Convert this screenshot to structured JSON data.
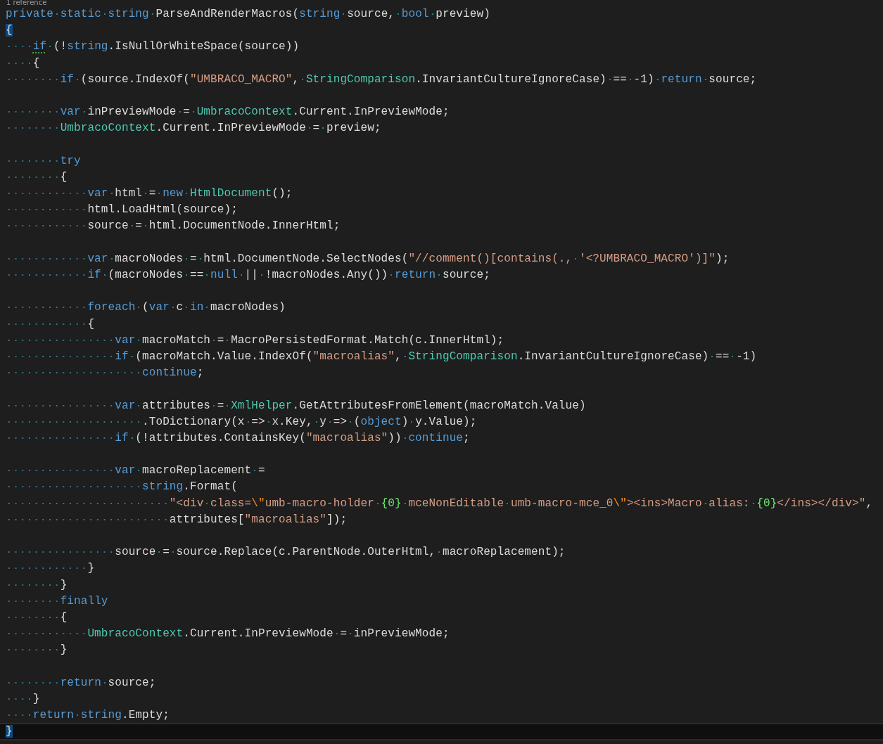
{
  "code_lens": "1 reference",
  "lines": [
    {
      "kind": "code",
      "current": false,
      "tokens": [
        {
          "kind": "kw",
          "text": "private static string "
        },
        {
          "kind": "txt",
          "text": "ParseAndRenderMacros("
        },
        {
          "kind": "kw",
          "text": "string"
        },
        {
          "kind": "txt",
          "text": " source, "
        },
        {
          "kind": "kw",
          "text": "bool"
        },
        {
          "kind": "txt",
          "text": " preview)"
        }
      ]
    },
    {
      "kind": "code",
      "current": false,
      "tokens": [
        {
          "kind": "match",
          "text": "{"
        }
      ]
    },
    {
      "kind": "code",
      "current": false,
      "tokens": [
        {
          "kind": "kwwarn",
          "text": "    if"
        },
        {
          "kind": "txt",
          "text": " (!"
        },
        {
          "kind": "kw",
          "text": "string"
        },
        {
          "kind": "txt",
          "text": ".IsNullOrWhiteSpace(source))"
        }
      ]
    },
    {
      "kind": "code",
      "current": false,
      "tokens": [
        {
          "kind": "txt",
          "text": "    {"
        }
      ]
    },
    {
      "kind": "code",
      "current": false,
      "tokens": [
        {
          "kind": "kw",
          "text": "        if"
        },
        {
          "kind": "txt",
          "text": " (source.IndexOf("
        },
        {
          "kind": "str",
          "text": "\"UMBRACO_MACRO\""
        },
        {
          "kind": "txt",
          "text": ", "
        },
        {
          "kind": "type",
          "text": "StringComparison"
        },
        {
          "kind": "txt",
          "text": ".InvariantCultureIgnoreCase) == -1) "
        },
        {
          "kind": "kw",
          "text": "return"
        },
        {
          "kind": "txt",
          "text": " source;"
        }
      ]
    },
    {
      "kind": "blank",
      "current": false
    },
    {
      "kind": "code",
      "current": false,
      "tokens": [
        {
          "kind": "kw",
          "text": "        var"
        },
        {
          "kind": "txt",
          "text": " inPreviewMode = "
        },
        {
          "kind": "type",
          "text": "UmbracoContext"
        },
        {
          "kind": "txt",
          "text": ".Current.InPreviewMode;"
        }
      ]
    },
    {
      "kind": "code",
      "current": false,
      "tokens": [
        {
          "kind": "type",
          "text": "        UmbracoContext"
        },
        {
          "kind": "txt",
          "text": ".Current.InPreviewMode = preview;"
        }
      ]
    },
    {
      "kind": "blank",
      "current": false
    },
    {
      "kind": "code",
      "current": false,
      "tokens": [
        {
          "kind": "kw",
          "text": "        try"
        }
      ]
    },
    {
      "kind": "code",
      "current": false,
      "tokens": [
        {
          "kind": "txt",
          "text": "        {"
        }
      ]
    },
    {
      "kind": "code",
      "current": false,
      "tokens": [
        {
          "kind": "kw",
          "text": "            var"
        },
        {
          "kind": "txt",
          "text": " html = "
        },
        {
          "kind": "kw",
          "text": "new "
        },
        {
          "kind": "type",
          "text": "HtmlDocument"
        },
        {
          "kind": "txt",
          "text": "();"
        }
      ]
    },
    {
      "kind": "code",
      "current": false,
      "tokens": [
        {
          "kind": "txt",
          "text": "            html.LoadHtml(source);"
        }
      ]
    },
    {
      "kind": "code",
      "current": false,
      "tokens": [
        {
          "kind": "txt",
          "text": "            source = html.DocumentNode.InnerHtml;"
        }
      ]
    },
    {
      "kind": "blank",
      "current": false
    },
    {
      "kind": "code",
      "current": false,
      "tokens": [
        {
          "kind": "kw",
          "text": "            var"
        },
        {
          "kind": "txt",
          "text": " macroNodes = html.DocumentNode.SelectNodes("
        },
        {
          "kind": "str",
          "text": "\"//comment()[contains(., '<?UMBRACO_MACRO')]\""
        },
        {
          "kind": "txt",
          "text": ");"
        }
      ]
    },
    {
      "kind": "code",
      "current": false,
      "tokens": [
        {
          "kind": "kw",
          "text": "            if"
        },
        {
          "kind": "txt",
          "text": " (macroNodes == "
        },
        {
          "kind": "kw",
          "text": "null"
        },
        {
          "kind": "txt",
          "text": " || !macroNodes.Any()) "
        },
        {
          "kind": "kw",
          "text": "return"
        },
        {
          "kind": "txt",
          "text": " source;"
        }
      ]
    },
    {
      "kind": "blank",
      "current": false
    },
    {
      "kind": "code",
      "current": false,
      "tokens": [
        {
          "kind": "kw",
          "text": "            foreach"
        },
        {
          "kind": "txt",
          "text": " ("
        },
        {
          "kind": "kw",
          "text": "var"
        },
        {
          "kind": "txt",
          "text": " c "
        },
        {
          "kind": "kw",
          "text": "in"
        },
        {
          "kind": "txt",
          "text": " macroNodes)"
        }
      ]
    },
    {
      "kind": "code",
      "current": false,
      "tokens": [
        {
          "kind": "txt",
          "text": "            {"
        }
      ]
    },
    {
      "kind": "code",
      "current": false,
      "tokens": [
        {
          "kind": "kw",
          "text": "                var"
        },
        {
          "kind": "txt",
          "text": " macroMatch = MacroPersistedFormat.Match(c.InnerHtml);"
        }
      ]
    },
    {
      "kind": "code",
      "current": false,
      "tokens": [
        {
          "kind": "kw",
          "text": "                if"
        },
        {
          "kind": "txt",
          "text": " (macroMatch.Value.IndexOf("
        },
        {
          "kind": "str",
          "text": "\"macroalias\""
        },
        {
          "kind": "txt",
          "text": ", "
        },
        {
          "kind": "type",
          "text": "StringComparison"
        },
        {
          "kind": "txt",
          "text": ".InvariantCultureIgnoreCase) == -1)"
        }
      ]
    },
    {
      "kind": "code",
      "current": false,
      "tokens": [
        {
          "kind": "kw",
          "text": "                    continue"
        },
        {
          "kind": "txt",
          "text": ";"
        }
      ]
    },
    {
      "kind": "blank",
      "current": false
    },
    {
      "kind": "code",
      "current": false,
      "tokens": [
        {
          "kind": "kw",
          "text": "                var"
        },
        {
          "kind": "txt",
          "text": " attributes = "
        },
        {
          "kind": "type",
          "text": "XmlHelper"
        },
        {
          "kind": "txt",
          "text": ".GetAttributesFromElement(macroMatch.Value)"
        }
      ]
    },
    {
      "kind": "code",
      "current": false,
      "tokens": [
        {
          "kind": "txt",
          "text": "                    .ToDictionary(x => x.Key, y => ("
        },
        {
          "kind": "kw",
          "text": "object"
        },
        {
          "kind": "txt",
          "text": ") y.Value);"
        }
      ]
    },
    {
      "kind": "code",
      "current": false,
      "tokens": [
        {
          "kind": "kw",
          "text": "                if"
        },
        {
          "kind": "txt",
          "text": " (!attributes.ContainsKey("
        },
        {
          "kind": "str",
          "text": "\"macroalias\""
        },
        {
          "kind": "txt",
          "text": ")) "
        },
        {
          "kind": "kw",
          "text": "continue"
        },
        {
          "kind": "txt",
          "text": ";"
        }
      ]
    },
    {
      "kind": "blank",
      "current": false
    },
    {
      "kind": "code",
      "current": false,
      "tokens": [
        {
          "kind": "kw",
          "text": "                var"
        },
        {
          "kind": "txt",
          "text": " macroReplacement ="
        }
      ]
    },
    {
      "kind": "code",
      "current": false,
      "tokens": [
        {
          "kind": "kw",
          "text": "                    string"
        },
        {
          "kind": "txt",
          "text": ".Format("
        }
      ]
    },
    {
      "kind": "code",
      "current": false,
      "tokens": [
        {
          "kind": "str",
          "text": "                        \"<div class="
        },
        {
          "kind": "esc",
          "text": "\\\""
        },
        {
          "kind": "str",
          "text": "umb-macro-holder "
        },
        {
          "kind": "fmt",
          "text": "{0}"
        },
        {
          "kind": "str",
          "text": " mceNonEditable umb-macro-mce_0"
        },
        {
          "kind": "esc",
          "text": "\\\""
        },
        {
          "kind": "str",
          "text": "><ins>Macro alias: "
        },
        {
          "kind": "fmt",
          "text": "{0}"
        },
        {
          "kind": "str",
          "text": "</ins></div>\""
        },
        {
          "kind": "txt",
          "text": ","
        }
      ]
    },
    {
      "kind": "code",
      "current": false,
      "tokens": [
        {
          "kind": "txt",
          "text": "                        attributes["
        },
        {
          "kind": "str",
          "text": "\"macroalias\""
        },
        {
          "kind": "txt",
          "text": "]);"
        }
      ]
    },
    {
      "kind": "blank",
      "current": false
    },
    {
      "kind": "code",
      "current": false,
      "tokens": [
        {
          "kind": "txt",
          "text": "                source = source.Replace(c.ParentNode.OuterHtml, macroReplacement);"
        }
      ]
    },
    {
      "kind": "code",
      "current": false,
      "tokens": [
        {
          "kind": "txt",
          "text": "            }"
        }
      ]
    },
    {
      "kind": "code",
      "current": false,
      "tokens": [
        {
          "kind": "txt",
          "text": "        }"
        }
      ]
    },
    {
      "kind": "code",
      "current": false,
      "tokens": [
        {
          "kind": "kw",
          "text": "        finally"
        }
      ]
    },
    {
      "kind": "code",
      "current": false,
      "tokens": [
        {
          "kind": "txt",
          "text": "        {"
        }
      ]
    },
    {
      "kind": "code",
      "current": false,
      "tokens": [
        {
          "kind": "type",
          "text": "            UmbracoContext"
        },
        {
          "kind": "txt",
          "text": ".Current.InPreviewMode = inPreviewMode;"
        }
      ]
    },
    {
      "kind": "code",
      "current": false,
      "tokens": [
        {
          "kind": "txt",
          "text": "        }"
        }
      ]
    },
    {
      "kind": "blank",
      "current": false
    },
    {
      "kind": "code",
      "current": false,
      "tokens": [
        {
          "kind": "kw",
          "text": "        return"
        },
        {
          "kind": "txt",
          "text": " source;"
        }
      ]
    },
    {
      "kind": "code",
      "current": false,
      "tokens": [
        {
          "kind": "txt",
          "text": "    }"
        }
      ]
    },
    {
      "kind": "code",
      "current": false,
      "tokens": [
        {
          "kind": "kw",
          "text": "    return string"
        },
        {
          "kind": "txt",
          "text": ".Empty;"
        }
      ]
    },
    {
      "kind": "code",
      "current": true,
      "tokens": [
        {
          "kind": "match",
          "text": "}"
        }
      ]
    }
  ]
}
